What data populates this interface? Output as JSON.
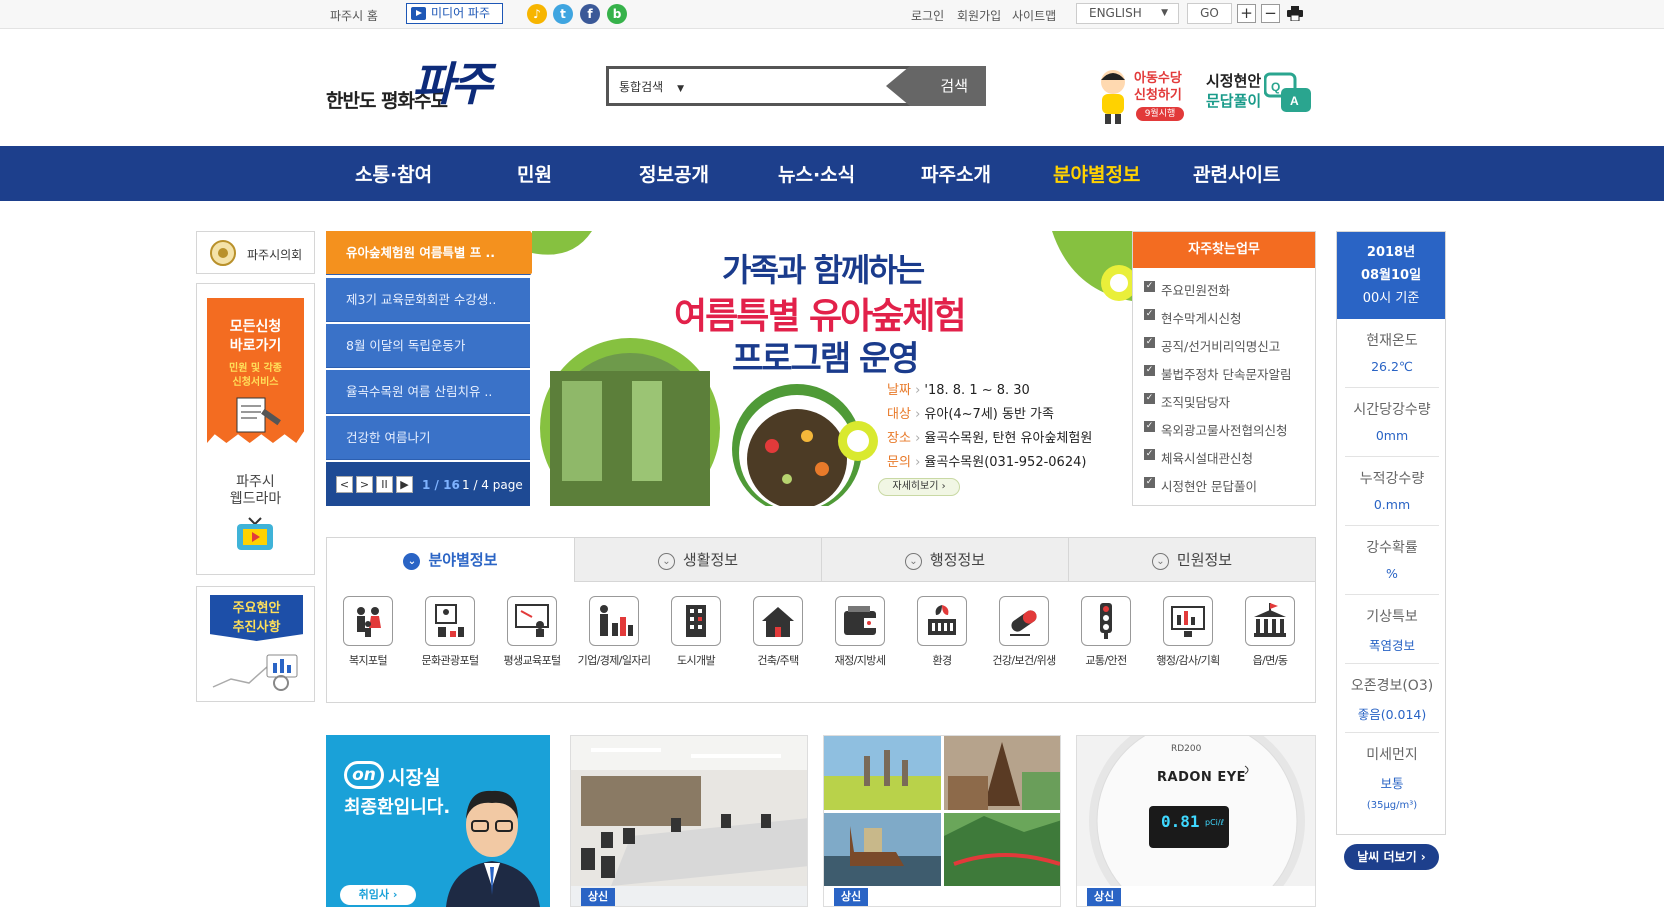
{
  "topbar": {
    "home": "파주시 홈",
    "media": "미디어 파주",
    "login": "로그인",
    "join": "회원가입",
    "sitemap": "사이트맵",
    "language": "ENGLISH",
    "go": "GO"
  },
  "header": {
    "logo_text": "한반도 평화수도",
    "logo_mark": "파주",
    "search_scope": "통합검색",
    "search_button": "검색",
    "child_allowance_l1": "아동수당",
    "child_allowance_l2": "신청하기",
    "child_allowance_badge": "9월시행",
    "qa_l1": "시정현안",
    "qa_l2": "문답풀이"
  },
  "nav": [
    "소통·참여",
    "민원",
    "정보공개",
    "뉴스·소식",
    "파주소개",
    "분야별정보",
    "관련사이트"
  ],
  "left": {
    "council": "파주시의회",
    "apply_l1": "모든신청",
    "apply_l2": "바로가기",
    "apply_sub1": "민원 및 각종",
    "apply_sub2": "신청서비스",
    "webdrama_l1": "파주시",
    "webdrama_l2": "웹드라마",
    "major_l1": "주요현안",
    "major_l2": "추진사항"
  },
  "slides": {
    "items": [
      "유아숲체험원 여름특별 프 ..",
      "제3기 교육문화회관 수강생..",
      "8월 이달의 독립운동가",
      "율곡수목원 여름 산림치유 ..",
      "건강한 여름나기"
    ],
    "counter_current": "1",
    "counter_total": "16",
    "page_info": "1 / 4 page",
    "title1": "가족과 함께하는",
    "title2": "여름특별 유아숲체험",
    "title3": "프로그램 운영",
    "details": [
      {
        "k": "날짜",
        "v": "'18. 8. 1 ~ 8. 30"
      },
      {
        "k": "대상",
        "v": "유아(4~7세) 동반 가족"
      },
      {
        "k": "장소",
        "v": "율곡수목원, 탄현 유아숲체험원"
      },
      {
        "k": "문의",
        "v": "율곡수목원(031-952-0624)"
      }
    ],
    "more": "자세히보기 ›"
  },
  "freq": {
    "title": "자주찾는업무",
    "items": [
      "주요민원전화",
      "현수막게시신청",
      "공직/선거비리익명신고",
      "불법주정차 단속문자알림",
      "조직및담당자",
      "옥외광고물사전협의신청",
      "체육시설대관신청",
      "시정현안 문답풀이"
    ]
  },
  "weather": {
    "year": "2018년",
    "date": "08월10일",
    "time": "00시 기준",
    "items": [
      {
        "k": "현재온도",
        "v": "26.2℃"
      },
      {
        "k": "시간당강수량",
        "v": "0mm"
      },
      {
        "k": "누적강수량",
        "v": "0.mm"
      },
      {
        "k": "강수확률",
        "v": "%"
      },
      {
        "k": "기상특보",
        "v": "폭염경보"
      },
      {
        "k": "오존경보(O3)",
        "v": "좋음(0.014)"
      },
      {
        "k": "미세먼지",
        "v": "보통"
      }
    ],
    "dust_value": "(35μg/m³)",
    "more": "날씨 더보기 ›"
  },
  "tabs": [
    "분야별정보",
    "생활정보",
    "행정정보",
    "민원정보"
  ],
  "categories": [
    "복지포털",
    "문화관광포털",
    "평생교육포털",
    "기업/경제/일자리",
    "도시개발",
    "건축/주택",
    "재정/지방세",
    "환경",
    "건강/보건/위생",
    "교통/안전",
    "행정/감사/기획",
    "읍/면/동"
  ],
  "cards": {
    "mayor_on": "on",
    "mayor_l1": "시장실",
    "mayor_l2": "최종환입니다.",
    "mayor_btn": "취임사 ›",
    "news_badge": "상신",
    "radon_brand": "RADON EYE",
    "radon_value": "0.81",
    "radon_unit": "pCi/ℓ",
    "radon_model": "RD200"
  },
  "colors": {
    "nav": "#1d3f8c",
    "nav_active": "#ffd200",
    "accent_blue": "#2a64c5",
    "orange": "#f36c21"
  }
}
